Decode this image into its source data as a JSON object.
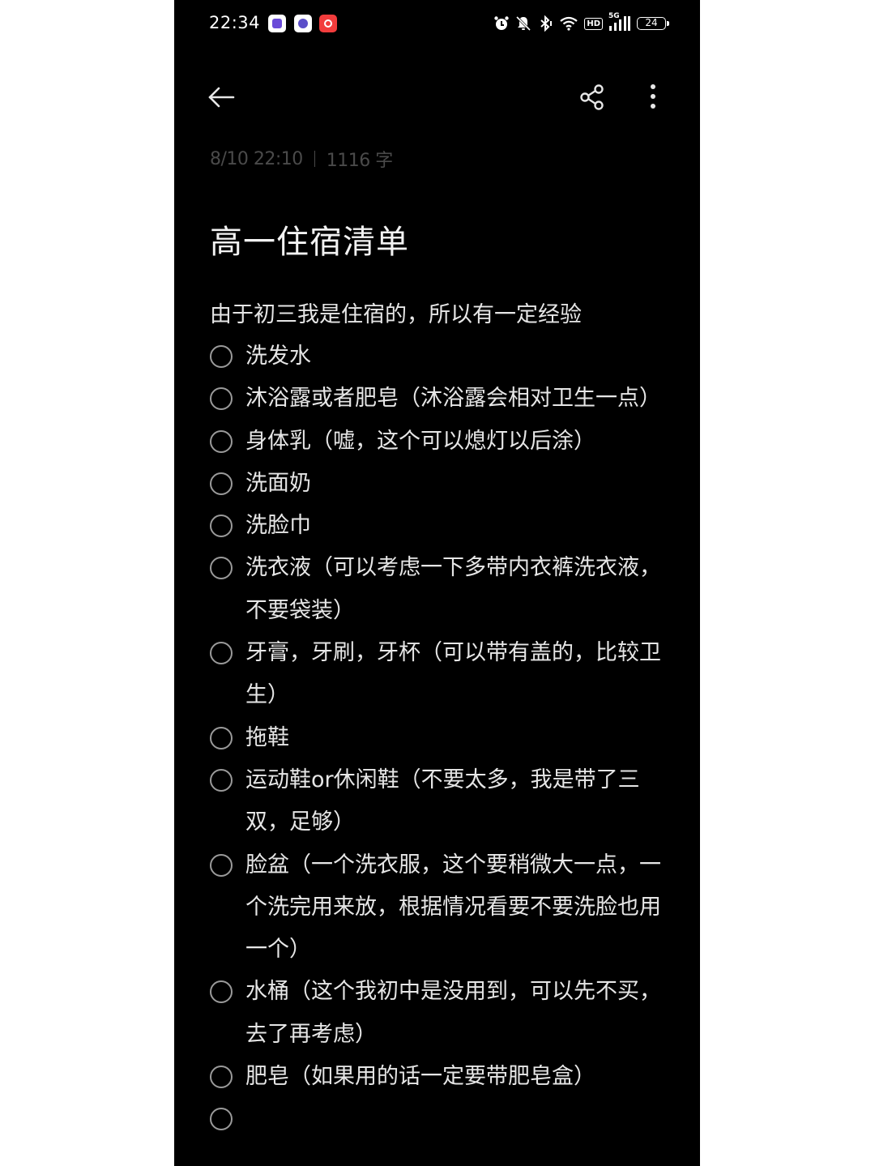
{
  "status_bar": {
    "time": "22:34",
    "network": "5G",
    "hd_label": "HD",
    "battery": "24",
    "icons": [
      "alarm-icon",
      "mute-icon",
      "bluetooth-icon",
      "wifi-icon",
      "hd-icon",
      "signal-icon",
      "battery-icon"
    ]
  },
  "toolbar": {
    "back_icon": "arrow-left-icon",
    "share_icon": "share-icon",
    "more_icon": "more-vertical-icon"
  },
  "note": {
    "timestamp": "8/10 22:10",
    "word_count": "1116 字",
    "title": "高一住宿清单",
    "intro": "由于初三我是住宿的，所以有一定经验",
    "items": [
      {
        "text": "洗发水",
        "checked": false
      },
      {
        "text": "沐浴露或者肥皂（沐浴露会相对卫生一点）",
        "checked": false
      },
      {
        "text": "身体乳（嘘，这个可以熄灯以后涂）",
        "checked": false
      },
      {
        "text": "洗面奶",
        "checked": false
      },
      {
        "text": "洗脸巾",
        "checked": false
      },
      {
        "text": "洗衣液（可以考虑一下多带内衣裤洗衣液，不要袋装）",
        "checked": false
      },
      {
        "text": "牙膏，牙刷，牙杯（可以带有盖的，比较卫生）",
        "checked": false
      },
      {
        "text": "拖鞋",
        "checked": false
      },
      {
        "text": "运动鞋or休闲鞋（不要太多，我是带了三双，足够）",
        "checked": false
      },
      {
        "text": "脸盆（一个洗衣服，这个要稍微大一点，一个洗完用来放，根据情况看要不要洗脸也用一个）",
        "checked": false
      },
      {
        "text": "水桶（这个我初中是没用到，可以先不买，去了再考虑）",
        "checked": false
      },
      {
        "text": "肥皂（如果用的话一定要带肥皂盒）",
        "checked": false
      },
      {
        "text": "",
        "checked": false
      }
    ]
  }
}
